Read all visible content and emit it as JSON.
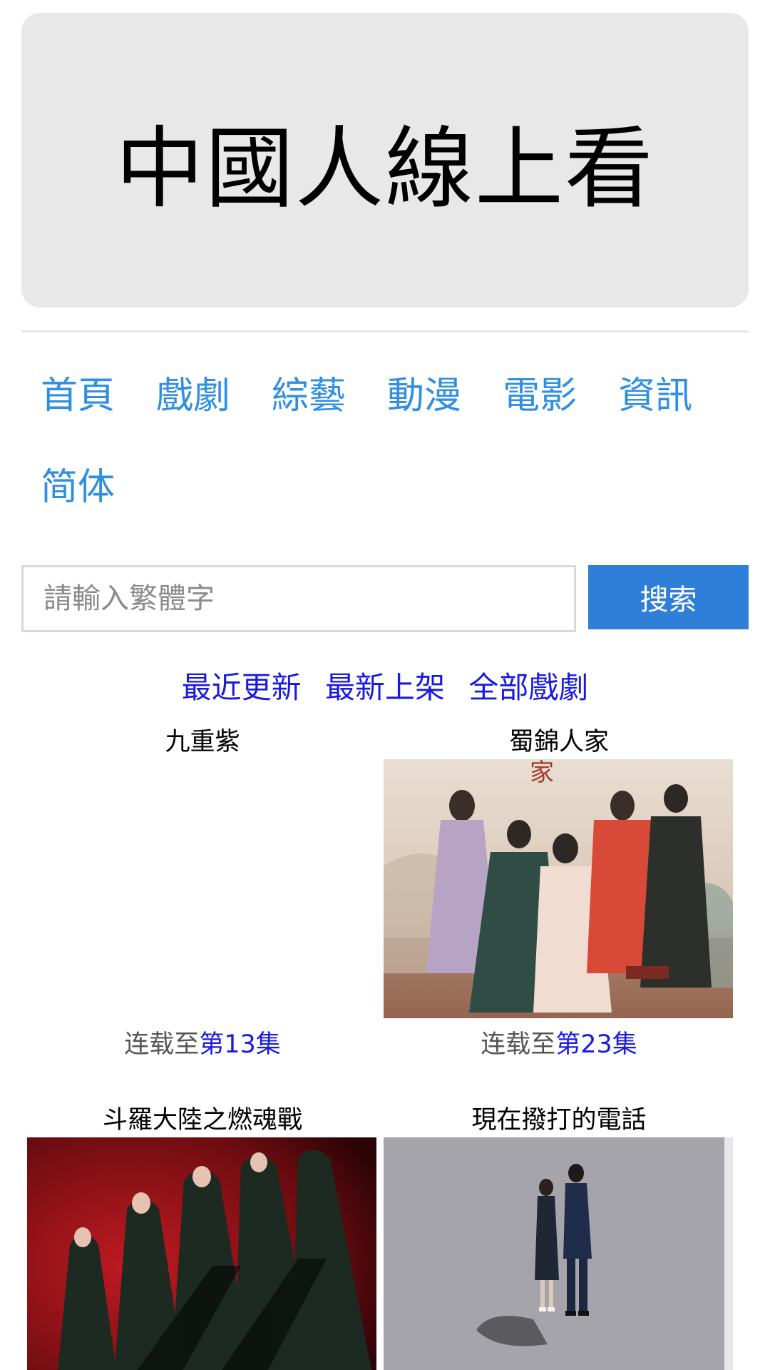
{
  "site": {
    "title": "中國人線上看"
  },
  "nav": {
    "items": [
      {
        "label": "首頁"
      },
      {
        "label": "戲劇"
      },
      {
        "label": "綜藝"
      },
      {
        "label": "動漫"
      },
      {
        "label": "電影"
      },
      {
        "label": "資訊"
      },
      {
        "label": "简体"
      }
    ]
  },
  "search": {
    "placeholder": "請輸入繁體字",
    "value": "",
    "button_label": "搜索"
  },
  "sublinks": [
    {
      "label": "最近更新"
    },
    {
      "label": "最新上架"
    },
    {
      "label": "全部戲劇"
    }
  ],
  "dramas": [
    {
      "title": "九重紫",
      "status_prefix": "连载至",
      "status_ep": "第13集",
      "poster": "none"
    },
    {
      "title": "蜀錦人家",
      "status_prefix": "连载至",
      "status_ep": "第23集",
      "poster": "ancient-costume-group"
    },
    {
      "title": "斗羅大陸之燃魂戰",
      "status_prefix": "",
      "status_ep": "",
      "poster": "red-group"
    },
    {
      "title": "現在撥打的電話",
      "status_prefix": "",
      "status_ep": "",
      "poster": "grey-couple"
    }
  ],
  "colors": {
    "link_blue": "#2f8fe0",
    "sublink_blue": "#1a1ae0",
    "button_blue": "#2f7fd8",
    "banner_grey": "#e8e8e8"
  }
}
